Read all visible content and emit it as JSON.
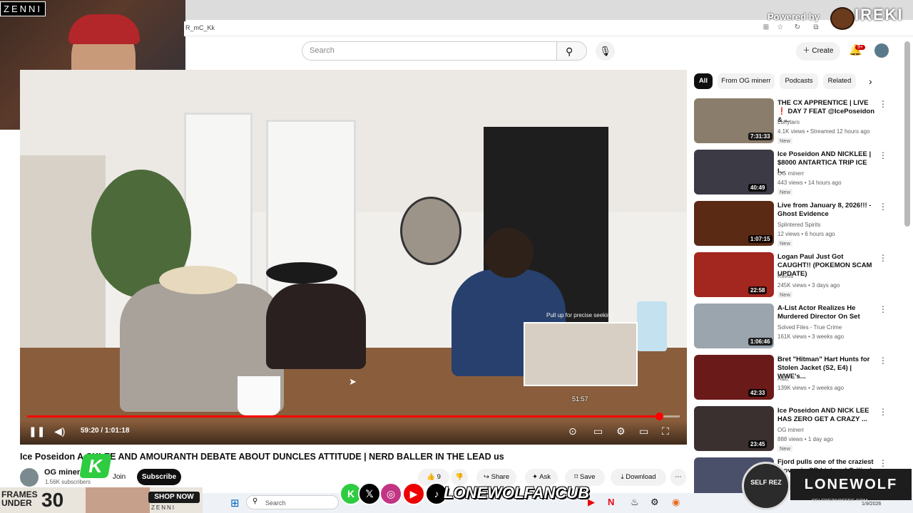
{
  "browser": {
    "url_fragment": "R_mC_Kk",
    "powered_by": "Powered by",
    "ireki": "IREKI"
  },
  "webcam": {
    "tag": "ZENNI"
  },
  "header": {
    "search_placeholder": "Search",
    "create_label": "Create",
    "notif_badge": "9+"
  },
  "player": {
    "current_time": "59:20",
    "duration": "1:01:18",
    "time_display": "59:20 / 1:01:18",
    "progress": 0.968,
    "seek_hint": "Pull up for precise seeking",
    "preview_time": "51:57"
  },
  "video": {
    "title": "Ice Poseidon A  CKLEE AND AMOURANTH DEBATE ABOUT DUNCLES ATTITUDE | NERD BALLER IN THE LEAD us",
    "channel": "OG minerr",
    "subscribers": "1.56K subscribers",
    "join_label": "Join",
    "subscribe_label": "Subscribe",
    "likes": "9",
    "share_label": "Share",
    "ask_label": "Ask",
    "save_label": "Save",
    "download_label": "Download"
  },
  "chips": [
    "All",
    "From OG minerr",
    "Podcasts",
    "Related"
  ],
  "recommendations": [
    {
      "title": "THE CX APPRENTICE | LIVE ❗ DAY 7 FEAT @IcePoseidon & ...",
      "channel": "Luffytaro",
      "meta": "4.1K views • Streamed 12 hours ago",
      "badge": "New",
      "duration": "7:31:33",
      "thumb": "#8b7d6b"
    },
    {
      "title": "Ice Poseidon AND NICKLEE | $8000 ANTARTICA TRIP ICE I...",
      "channel": "OG minerr",
      "meta": "443 views • 14 hours ago",
      "badge": "New",
      "duration": "40:49",
      "thumb": "#3c3a44"
    },
    {
      "title": "Live from January 8, 2026!!! - Ghost Evidence",
      "channel": "Splintered Spirits",
      "meta": "12 views • 6 hours ago",
      "badge": "New",
      "duration": "1:07:15",
      "thumb": "#5a2a14"
    },
    {
      "title": "Logan Paul Just Got CAUGHT!! (POKEMON SCAM UPDATE)",
      "channel": "Kavos",
      "meta": "245K views • 3 days ago",
      "badge": "New",
      "duration": "22:58",
      "thumb": "#a3261f"
    },
    {
      "title": "A-List Actor Realizes He Murdered Director On Set",
      "channel": "Solved Files - True Crime",
      "meta": "161K views • 3 weeks ago",
      "badge": "",
      "duration": "1:06:46",
      "thumb": "#9aa5ae"
    },
    {
      "title": "Bret \"Hitman\" Hart Hunts for Stolen Jacket (S2, E4) | WWE's...",
      "channel": "A&E",
      "meta": "139K views • 2 weeks ago",
      "badge": "",
      "duration": "42:33",
      "thumb": "#6b1a1a"
    },
    {
      "title": "Ice Poseidon AND NICK LEE HAS ZERO GET A CRAZY ...",
      "channel": "OG minerr",
      "meta": "888 views • 1 day ago",
      "badge": "New",
      "duration": "23:45",
      "thumb": "#3a3030"
    },
    {
      "title": "Fjord pulls one of the craziest moves in CR history | Critical ...",
      "channel": "",
      "meta": "",
      "badge": "",
      "duration": "",
      "thumb": "#4a4f6a"
    }
  ],
  "overlays": {
    "ad_line1": "FRAMES",
    "ad_line2": "UNDER",
    "ad_number": "30",
    "ad_shop": "SHOP NOW",
    "ad_brand": "ZENNI",
    "social_handle": "LONEWOLFANCUB",
    "self_rez": "SELF REZ",
    "lonewolf": "LONEWOLF",
    "self_rez_url": "SELFREZCOFFEE.COM",
    "k_logo": "K"
  },
  "taskbar": {
    "search_label": "Search",
    "date": "1/9/2026"
  },
  "icons": {
    "search": "search-icon",
    "mic": "mic-icon",
    "bell": "bell-icon",
    "plus": "plus-icon",
    "pause": "pause-icon",
    "volume": "volume-icon",
    "settings": "gear-icon",
    "fullscreen": "fullscreen-icon"
  }
}
